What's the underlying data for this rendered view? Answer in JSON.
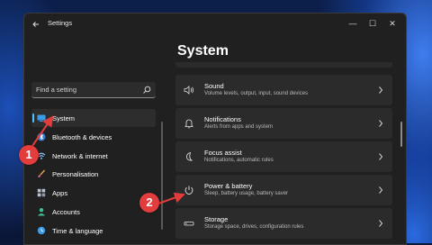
{
  "window": {
    "app_title": "Settings",
    "controls": {
      "minimize": "—",
      "maximize": "☐",
      "close": "✕"
    }
  },
  "search": {
    "placeholder": "Find a setting"
  },
  "sidebar": {
    "items": [
      {
        "label": "System",
        "icon": "system-icon",
        "active": true
      },
      {
        "label": "Bluetooth & devices",
        "icon": "bluetooth-icon"
      },
      {
        "label": "Network & internet",
        "icon": "network-icon"
      },
      {
        "label": "Personalisation",
        "icon": "personalisation-icon"
      },
      {
        "label": "Apps",
        "icon": "apps-icon"
      },
      {
        "label": "Accounts",
        "icon": "accounts-icon"
      },
      {
        "label": "Time & language",
        "icon": "time-language-icon"
      }
    ]
  },
  "main": {
    "title": "System",
    "cards": [
      {
        "title": "Sound",
        "subtitle": "Volume levels, output, input, sound devices",
        "icon": "speaker-icon"
      },
      {
        "title": "Notifications",
        "subtitle": "Alerts from apps and system",
        "icon": "bell-icon"
      },
      {
        "title": "Focus assist",
        "subtitle": "Notifications, automatic rules",
        "icon": "moon-icon"
      },
      {
        "title": "Power & battery",
        "subtitle": "Sleep, battery usage, battery saver",
        "icon": "power-icon"
      },
      {
        "title": "Storage",
        "subtitle": "Storage space, drives, configuration rules",
        "icon": "storage-icon"
      }
    ]
  },
  "annotations": {
    "badge1": "1",
    "badge2": "2",
    "color": "#e23c3c"
  },
  "colors": {
    "accent": "#4cc2ff",
    "window_bg": "#202020",
    "card_bg": "#2b2b2b"
  }
}
